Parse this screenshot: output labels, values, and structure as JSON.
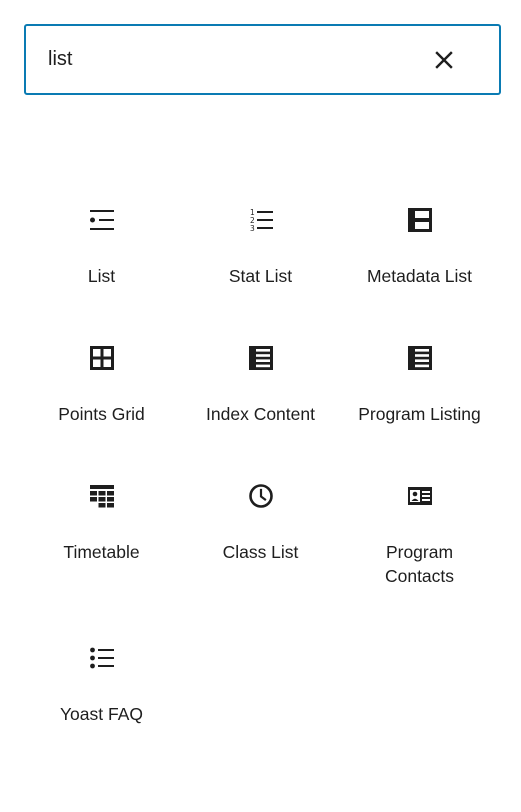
{
  "search": {
    "value": "list",
    "clear_icon": "close-icon"
  },
  "blocks": [
    {
      "label": "List",
      "icon": "bulleted-list-icon"
    },
    {
      "label": "Stat List",
      "icon": "numbered-list-icon"
    },
    {
      "label": "Metadata List",
      "icon": "metadata-table-icon"
    },
    {
      "label": "Points Grid",
      "icon": "grid-icon"
    },
    {
      "label": "Index Content",
      "icon": "rows-list-icon"
    },
    {
      "label": "Program Listing",
      "icon": "rows-list-icon"
    },
    {
      "label": "Timetable",
      "icon": "table-icon"
    },
    {
      "label": "Class List",
      "icon": "clock-icon"
    },
    {
      "label": "Program\nContacts",
      "icon": "contact-card-icon"
    },
    {
      "label": "Yoast FAQ",
      "icon": "bullet-list-icon"
    }
  ]
}
